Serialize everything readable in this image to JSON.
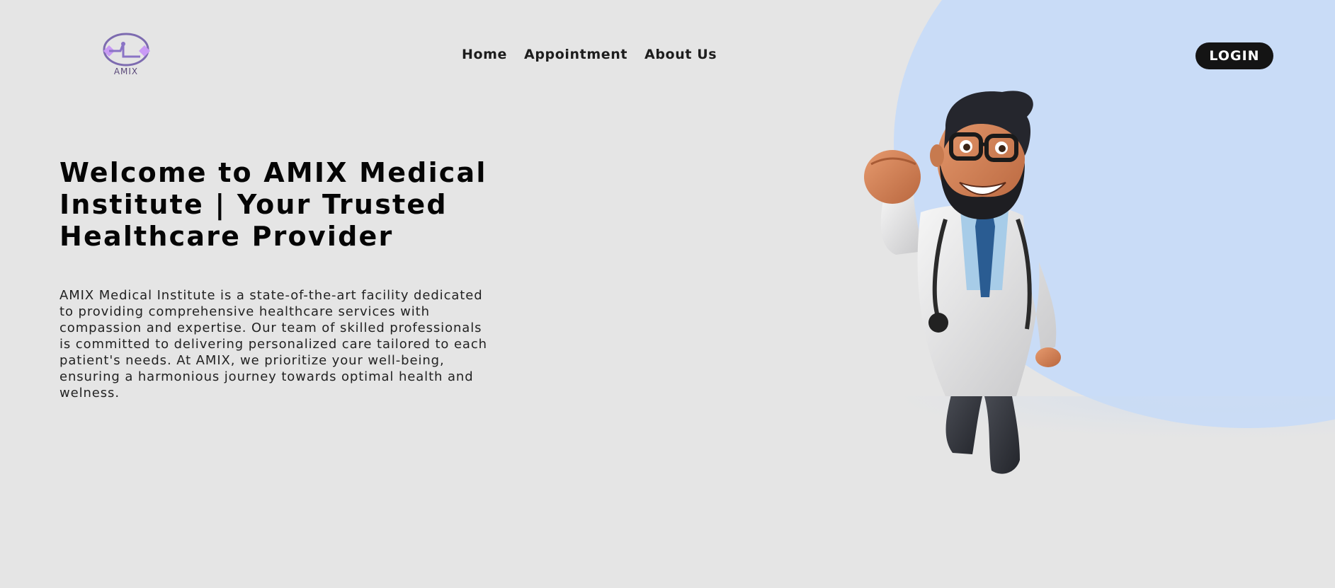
{
  "brand": {
    "logo_text": "AMIX",
    "logo_color": "#b98cf0"
  },
  "nav": {
    "items": [
      {
        "label": "Home"
      },
      {
        "label": "Appointment"
      },
      {
        "label": "About Us"
      }
    ]
  },
  "header": {
    "login_label": "LOGIN"
  },
  "hero": {
    "title": "Welcome to AMIX Medical Institute | Your Trusted Healthcare Provider",
    "description": "AMIX Medical Institute is a state-of-the-art facility dedicated to providing comprehensive healthcare services with compassion and expertise. Our team of skilled professionals is committed to delivering personalized care tailored to each patient's needs. At AMIX, we prioritize your well-being, ensuring a harmonious journey towards optimal health and welness."
  },
  "colors": {
    "background": "#e5e5e5",
    "accent_blob": "#c9dcf7",
    "button_bg": "#141414",
    "button_text": "#ffffff"
  },
  "illustration": {
    "subject": "cartoon-doctor-flying"
  }
}
